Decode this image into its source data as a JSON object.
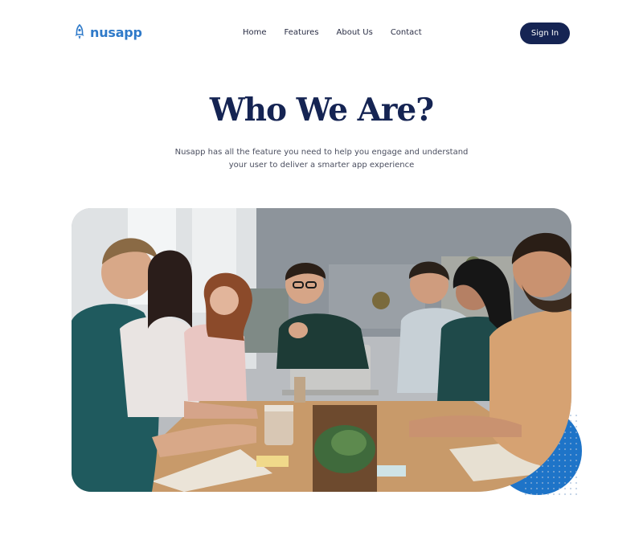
{
  "brand": {
    "name": "nusapp",
    "accent": "#2f7ac9",
    "dark": "#152453"
  },
  "nav": {
    "items": [
      "Home",
      "Features",
      "About Us",
      "Contact"
    ],
    "signin_label": "Sign In"
  },
  "hero": {
    "title": "Who We Are?",
    "subtitle_line1": "Nusapp has all the feature you need to help you engage and understand",
    "subtitle_line2": "your user to deliver a smarter app experience"
  },
  "decor": {
    "circle_color": "#1e74c8"
  }
}
